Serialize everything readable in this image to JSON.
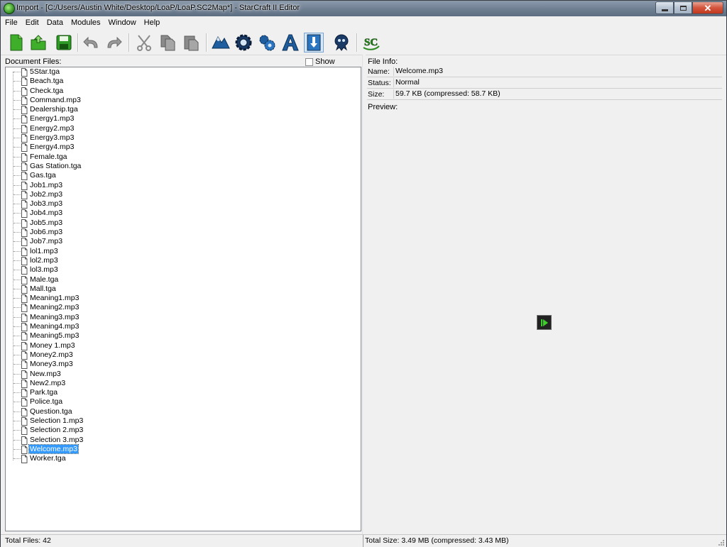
{
  "window": {
    "title": "Import - [C:/Users/Austin White/Desktop/LoaP/LoaP.SC2Map*] - StarCraft II Editor"
  },
  "menu": [
    "File",
    "Edit",
    "Data",
    "Modules",
    "Window",
    "Help"
  ],
  "toolbar": {
    "buttons": [
      {
        "name": "new-document-icon"
      },
      {
        "name": "open-document-icon"
      },
      {
        "name": "save-icon"
      },
      {
        "name": "undo-icon"
      },
      {
        "name": "redo-icon"
      },
      {
        "name": "cut-icon"
      },
      {
        "name": "copy-icon"
      },
      {
        "name": "paste-icon"
      },
      {
        "name": "terrain-module-icon"
      },
      {
        "name": "triggers-module-icon"
      },
      {
        "name": "data-module-icon"
      },
      {
        "name": "text-module-icon"
      },
      {
        "name": "import-module-icon"
      },
      {
        "name": "cutscene-module-icon"
      },
      {
        "name": "sc-logo-icon"
      }
    ]
  },
  "left": {
    "header": "Document Files:",
    "show_reserved_label": "Show Reserved",
    "files": [
      "5Star.tga",
      "Beach.tga",
      "Check.tga",
      "Command.mp3",
      "Dealership.tga",
      "Energy1.mp3",
      "Energy2.mp3",
      "Energy3.mp3",
      "Energy4.mp3",
      "Female.tga",
      "Gas Station.tga",
      "Gas.tga",
      "Job1.mp3",
      "Job2.mp3",
      "Job3.mp3",
      "Job4.mp3",
      "Job5.mp3",
      "Job6.mp3",
      "Job7.mp3",
      "lol1.mp3",
      "lol2.mp3",
      "lol3.mp3",
      "Male.tga",
      "Mall.tga",
      "Meaning1.mp3",
      "Meaning2.mp3",
      "Meaning3.mp3",
      "Meaning4.mp3",
      "Meaning5.mp3",
      "Money 1.mp3",
      "Money2.mp3",
      "Money3.mp3",
      "New.mp3",
      "New2.mp3",
      "Park.tga",
      "Police.tga",
      "Question.tga",
      "Selection 1.mp3",
      "Selection 2.mp3",
      "Selection 3.mp3",
      "Welcome.mp3",
      "Worker.tga"
    ],
    "selected_index": 40
  },
  "right": {
    "file_info_label": "File Info:",
    "name_key": "Name:",
    "name_value": "Welcome.mp3",
    "status_key": "Status:",
    "status_value": "Normal",
    "size_key": "Size:",
    "size_value": "59.7 KB (compressed: 58.7 KB)",
    "preview_label": "Preview:"
  },
  "statusbar": {
    "total_files": "Total Files: 42",
    "total_size": "Total Size: 3.49 MB (compressed: 3.43 MB)"
  },
  "colors": {
    "selection": "#3399ff",
    "titlebar": "#6f7f92"
  }
}
